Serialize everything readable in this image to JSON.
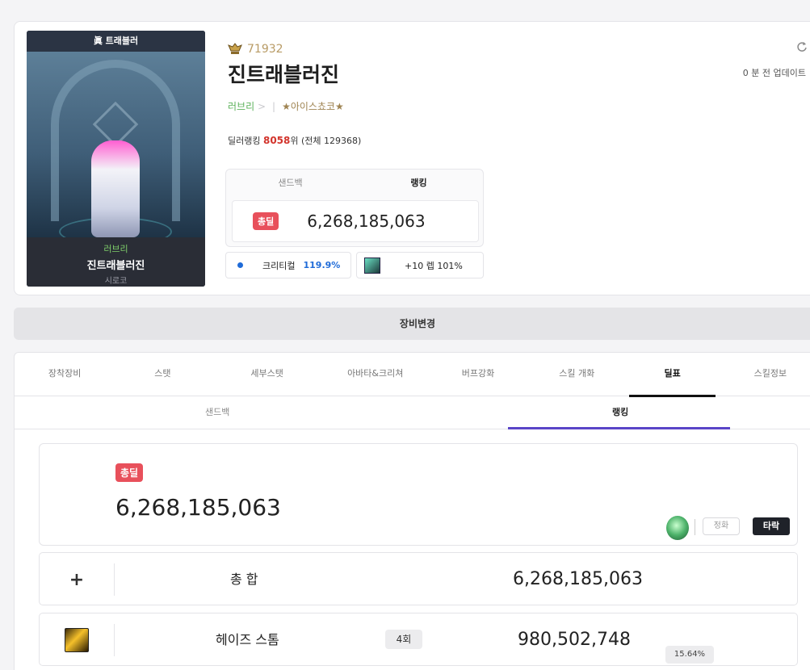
{
  "portrait": {
    "class_label": "眞 트래블러",
    "guild": "러브리",
    "name": "진트래블러진",
    "server": "시로코"
  },
  "profile": {
    "fame": "71932",
    "name": "진트래블러진",
    "guild": "러브리",
    "guild_arrow": ">",
    "separator": "|",
    "adventure": "★아이스쵸코★",
    "rank_prefix": "딜러랭킹",
    "rank_value": "8058",
    "rank_suffix": "위 (전체 129368)",
    "updated": "0 분 전 업데이트"
  },
  "mini_panel": {
    "tabs": [
      "샌드백",
      "랭킹"
    ],
    "badge": "총딜",
    "total": "6,268,185,063"
  },
  "stats": {
    "crit_label": "크리티컬",
    "crit_value": "119.9%",
    "equip_text": "+10 렙 101%"
  },
  "change_equipment": "장비변경",
  "main_tabs": [
    "장착장비",
    "스탯",
    "세부스탯",
    "아바타&크리쳐",
    "버프강화",
    "스킬 개화",
    "딜표",
    "스킬정보"
  ],
  "sub_tabs": [
    "샌드백",
    "랭킹"
  ],
  "total_card": {
    "badge": "총딜",
    "value": "6,268,185,063",
    "purify": "정화",
    "fall": "타락"
  },
  "rows": [
    {
      "icon": "plus-icon",
      "label": "총 합",
      "value": "6,268,185,063"
    },
    {
      "icon": "skill-icon",
      "label": "헤이즈 스톰",
      "count": "4회",
      "value": "980,502,748",
      "percent": "15.64%"
    }
  ],
  "colors": {
    "badge_red": "#e8505b",
    "rank_red": "#d2342c",
    "crit_blue": "#1f6bd8",
    "sub_underline": "#5a45c8",
    "guild_green": "#5cb25a",
    "fame_gold": "#b89b65"
  }
}
